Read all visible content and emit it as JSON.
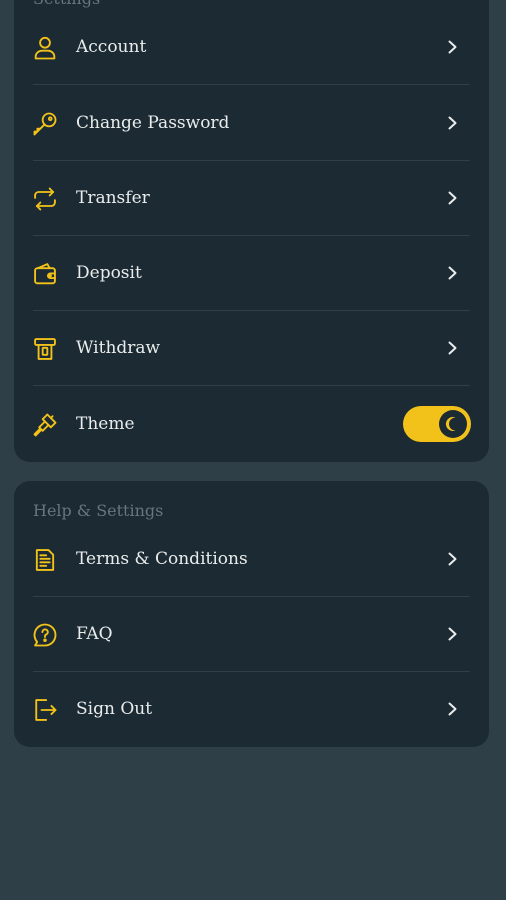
{
  "colors": {
    "background": "#2e3f47",
    "card": "#1c2b33",
    "accent": "#f2c21a",
    "text": "#e9ecec",
    "muted": "#66767d"
  },
  "settings": {
    "title": "Settings",
    "items": [
      {
        "label": "Account",
        "icon": "user-icon"
      },
      {
        "label": "Change Password",
        "icon": "key-icon"
      },
      {
        "label": "Transfer",
        "icon": "transfer-arrows-icon"
      },
      {
        "label": "Deposit",
        "icon": "wallet-icon"
      },
      {
        "label": "Withdraw",
        "icon": "atm-withdraw-icon"
      },
      {
        "label": "Theme",
        "icon": "paintbrush-icon",
        "toggle": "on",
        "toggle_icon": "moon-icon"
      }
    ]
  },
  "help": {
    "title": "Help & Settings",
    "items": [
      {
        "label": "Terms & Conditions",
        "icon": "document-icon"
      },
      {
        "label": "FAQ",
        "icon": "question-bubble-icon"
      },
      {
        "label": "Sign Out",
        "icon": "sign-out-icon"
      }
    ]
  }
}
